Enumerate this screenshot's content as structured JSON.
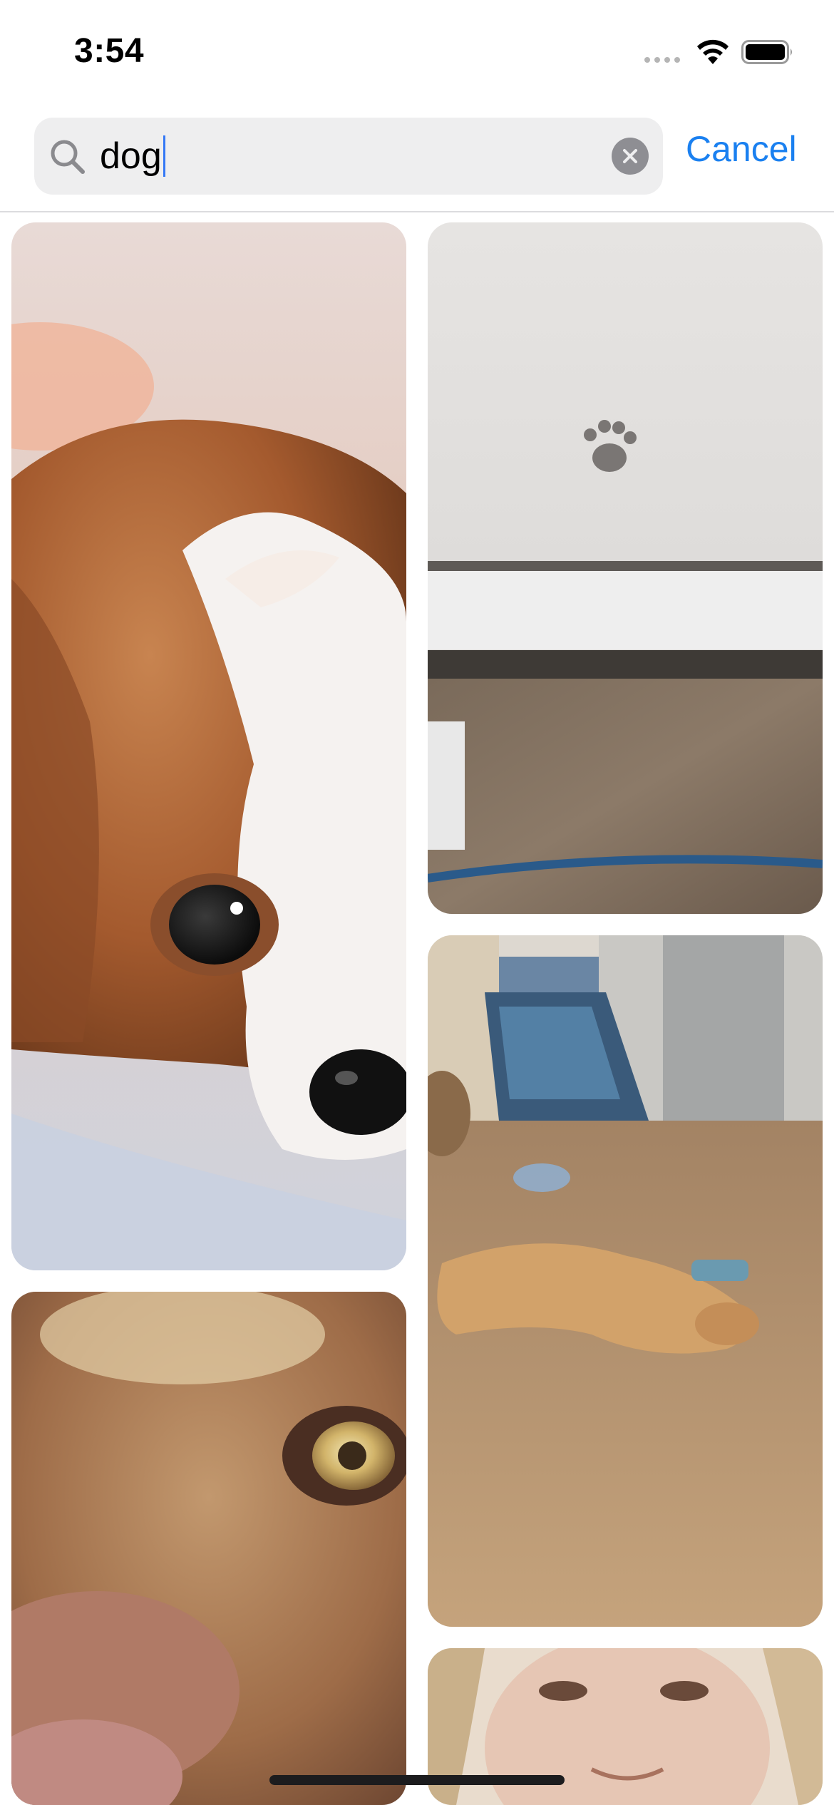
{
  "status_bar": {
    "time": "3:54",
    "icons": [
      "cellular-signal-icon",
      "wifi-icon",
      "battery-icon"
    ]
  },
  "search": {
    "query": "dog",
    "cancel_label": "Cancel",
    "accent_color": "#1a80f0"
  },
  "results": [
    {
      "name": "photo-dog-cavalier-closeup",
      "description": "cavalier-king-charles-spaniel"
    },
    {
      "name": "photo-paw-print-snow"
    },
    {
      "name": "photo-dog-sleeping-floor"
    },
    {
      "name": "photo-dog-brown-eye-closeup"
    },
    {
      "name": "photo-person-partial"
    }
  ]
}
